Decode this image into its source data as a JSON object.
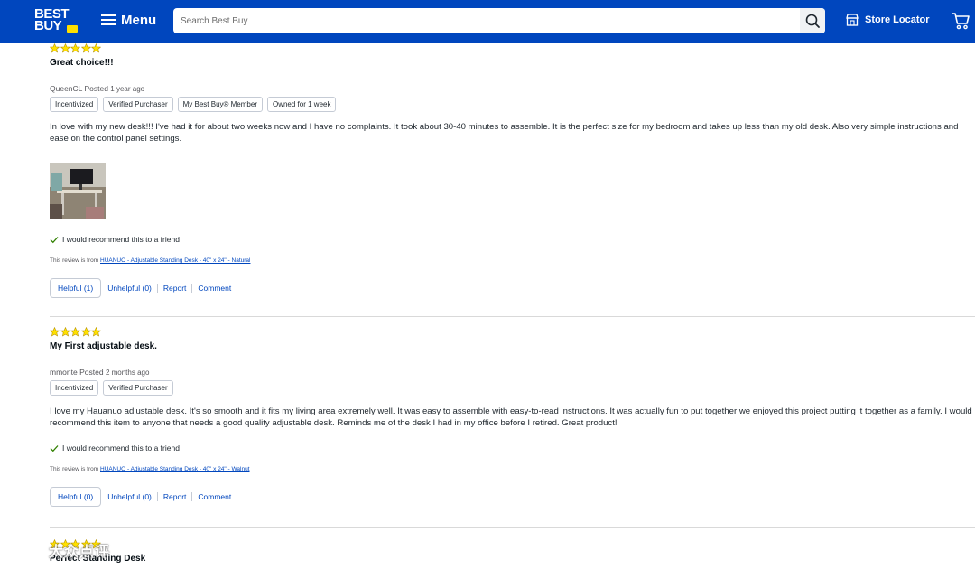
{
  "header": {
    "logo_text": "BEST BUY",
    "menu_label": "Menu",
    "search_placeholder": "Search Best Buy",
    "store_locator_label": "Store Locator",
    "colors": {
      "brand_blue": "#0046be",
      "logo_yellow": "#ffe000"
    }
  },
  "reviews": [
    {
      "rating": 5,
      "title": "Great choice!!!",
      "author": "QueenCL",
      "posted": "Posted",
      "posted_time": "1 year ago",
      "badges": [
        "Incentivized",
        "Verified Purchaser",
        "My Best Buy® Member",
        "Owned for 1 week"
      ],
      "body": "In love with my new desk!!! I've had it for about two weeks now and I have no complaints. It took about 30-40 minutes to assemble. It is the perfect size for my bedroom and takes up less than my old desk. Also very simple instructions and ease on the control panel settings.",
      "has_photo": true,
      "recommend": "I would recommend this to a friend",
      "source_prefix": "This review is from",
      "source_product": "HUANUO - Adjustable Standing Desk - 40\" x 24\" - Natural",
      "helpful": "Helpful (1)",
      "unhelpful": "Unhelpful (0)",
      "report": "Report",
      "comment": "Comment"
    },
    {
      "rating": 5,
      "title": "My First adjustable desk.",
      "author": "mmonte",
      "posted": "Posted",
      "posted_time": "2 months ago",
      "badges": [
        "Incentivized",
        "Verified Purchaser"
      ],
      "body": "I love my Hauanuo adjustable desk. It's so smooth and it fits my living area extremely well. It was easy to assemble with easy-to-read instructions. It was actually fun to put together we enjoyed this project putting it together as a family. I would recommend this item to anyone that needs a good quality adjustable desk. Reminds me of the desk I had in my office before I retired. Great product!",
      "has_photo": false,
      "recommend": "I would recommend this to a friend",
      "source_prefix": "This review is from",
      "source_product": "HUANUO - Adjustable Standing Desk - 40\" x 24\" - Walnut",
      "helpful": "Helpful (0)",
      "unhelpful": "Unhelpful (0)",
      "report": "Report",
      "comment": "Comment"
    },
    {
      "rating": 5,
      "title": "Perfect Standing Desk"
    }
  ],
  "watermark": {
    "text": "大众点评"
  },
  "icons": {
    "search": "search-icon",
    "store": "store-icon",
    "cart": "cart-icon",
    "star": "star-icon",
    "check": "check-icon"
  }
}
